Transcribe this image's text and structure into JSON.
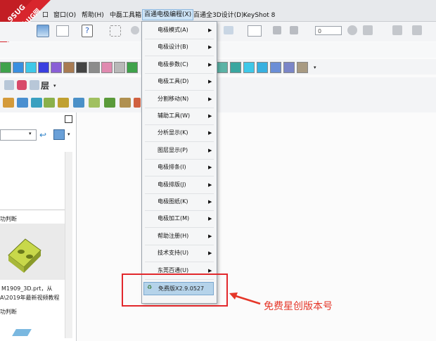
{
  "menubar": {
    "items": [
      {
        "key": "truncated",
        "label": "口"
      },
      {
        "key": "window",
        "label": "窗口(O)"
      },
      {
        "key": "help",
        "label": "帮助(H)"
      },
      {
        "key": "toolbox",
        "label": "中磊工具箱"
      },
      {
        "key": "electrode",
        "label": "百通电极编程(X)"
      },
      {
        "key": "design3d",
        "label": "百通全3D设计(D)"
      },
      {
        "key": "keyshot",
        "label": "KeyShot 8"
      }
    ]
  },
  "watermark": {
    "line1": "9SUG",
    "line2": "学UG就上UG网",
    "color": "#d8262d"
  },
  "electrode_menu": {
    "items": [
      "电极模式(A)",
      "电极设计(B)",
      "电极参数(C)",
      "电极工具(D)",
      "分割移动(N)",
      "辅助工具(W)",
      "分析显示(K)",
      "图层显示(P)",
      "电极排条(I)",
      "电极排版(J)",
      "电极图纸(K)",
      "电极加工(M)",
      "帮助注册(H)",
      "技术支持(U)",
      "东莞百通(U)"
    ],
    "version_item": "免费版X2.9.0527"
  },
  "left_panel": {
    "section1_label": "功判断",
    "file_name": "M1909_3D.prt，从",
    "file_desc": "A\\2019年最新视频教程",
    "section2_label": "功判断"
  },
  "annotation": {
    "text": "免费星创版本号",
    "color": "#e53628"
  },
  "toolbar": {
    "combo_value": "0",
    "layer_label": "层"
  },
  "colors": {
    "swatches_left": [
      "#3fa24b",
      "#3a8fe0",
      "#3fc8e8",
      "#3a3fe0",
      "#8a5fd6",
      "#a87b52",
      "#444444",
      "#8c8c8c",
      "#e08ab0",
      "#b8b8b8",
      "#3fa24b"
    ],
    "swatches_right": [
      "#5bb3a6",
      "#3aa6a0",
      "#3fc8e8",
      "#38b0e0",
      "#6b8ed6",
      "#7b86c8",
      "#a89a82"
    ],
    "menu_highlight": "#b5d3ea",
    "annotation_box": "#e2282c"
  }
}
